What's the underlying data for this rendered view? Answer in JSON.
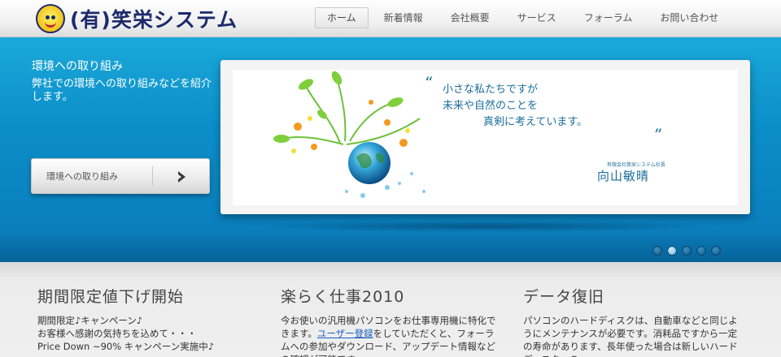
{
  "header": {
    "logo_text": "(有)笑栄システム",
    "nav": [
      {
        "label": "ホーム",
        "active": true
      },
      {
        "label": "新着情報",
        "active": false
      },
      {
        "label": "会社概要",
        "active": false
      },
      {
        "label": "サービス",
        "active": false
      },
      {
        "label": "フォーラム",
        "active": false
      },
      {
        "label": "お問い合わせ",
        "active": false
      }
    ]
  },
  "hero": {
    "title": "環境への取り組み",
    "description": "弊社での環境への取り組みなどを紹介します。",
    "button_label": "環境への取り組み",
    "slide": {
      "quote_line1": "小さな私たちですが",
      "quote_line2": "未来や自然のことを",
      "quote_line3": "真剣に考えています。",
      "signature_title": "有限会社笑栄システム社長",
      "signature_name": "向山敏晴"
    },
    "slider_dots": 5,
    "active_dot": 1
  },
  "columns": [
    {
      "title": "期間限定値下げ開始",
      "lines": [
        "期間限定♪キャンペーン♪",
        "お客様へ感謝の気持ちを込めて・・・",
        "Price Down ~90% キャンペーン実施中♪"
      ]
    },
    {
      "title": "楽らく仕事2010",
      "text_before_link": "今お使いの汎用機パソコンをお仕事専用機に特化できます。",
      "link": "ユーザー登録",
      "text_after_link": "をしていただくと、フォーラムへの参加やダウンロード、アップデート情報などの確認が可能です。"
    },
    {
      "title": "データ復旧",
      "text": "パソコンのハードディスクは、自動車などと同じようにメンテナンスが必要です。消耗品ですから一定の寿命があります、長年使った場合は新しいハードディスクへの"
    }
  ],
  "colors": {
    "brand": "#1c2a6b",
    "hero": "#0b8ec8",
    "link": "#1a5fbf"
  }
}
